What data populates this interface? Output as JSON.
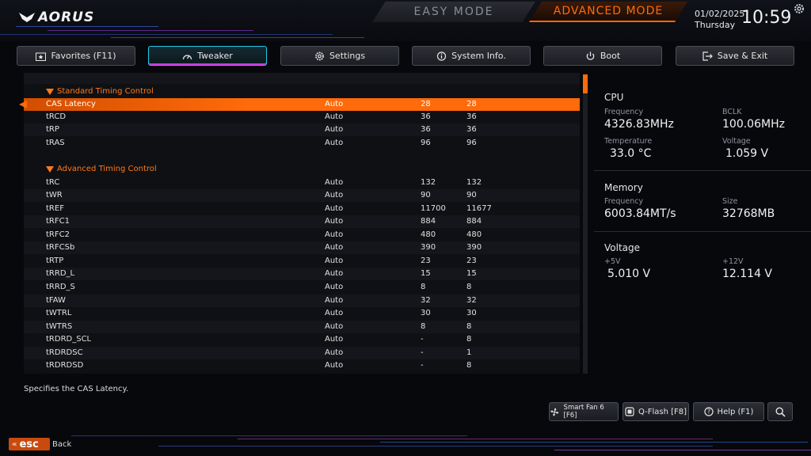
{
  "header": {
    "logo": "AORUS",
    "modes": {
      "easy": "EASY MODE",
      "advanced": "ADVANCED MODE"
    },
    "date": "01/02/2025",
    "day": "Thursday",
    "time": "10:59"
  },
  "tabs": [
    {
      "label": "Favorites (F11)",
      "icon": "star-folder-icon"
    },
    {
      "label": "Tweaker",
      "icon": "speedometer-icon",
      "active": true
    },
    {
      "label": "Settings",
      "icon": "gear-icon"
    },
    {
      "label": "System Info.",
      "icon": "info-icon"
    },
    {
      "label": "Boot",
      "icon": "power-icon"
    },
    {
      "label": "Save & Exit",
      "icon": "exit-icon"
    }
  ],
  "sections": [
    {
      "label": "Standard Timing Control"
    },
    {
      "label": "Advanced Timing Control"
    }
  ],
  "standard_rows": [
    {
      "name": "CAS Latency",
      "mode": "Auto",
      "a": "28",
      "b": "28",
      "selected": true
    },
    {
      "name": "tRCD",
      "mode": "Auto",
      "a": "36",
      "b": "36"
    },
    {
      "name": "tRP",
      "mode": "Auto",
      "a": "36",
      "b": "36"
    },
    {
      "name": "tRAS",
      "mode": "Auto",
      "a": "96",
      "b": "96"
    }
  ],
  "advanced_rows": [
    {
      "name": "tRC",
      "mode": "Auto",
      "a": "132",
      "b": "132"
    },
    {
      "name": "tWR",
      "mode": "Auto",
      "a": "90",
      "b": "90"
    },
    {
      "name": "tREF",
      "mode": "Auto",
      "a": "11700",
      "b": "11677"
    },
    {
      "name": "tRFC1",
      "mode": "Auto",
      "a": "884",
      "b": "884"
    },
    {
      "name": "tRFC2",
      "mode": "Auto",
      "a": "480",
      "b": "480"
    },
    {
      "name": "tRFCSb",
      "mode": "Auto",
      "a": "390",
      "b": "390"
    },
    {
      "name": "tRTP",
      "mode": "Auto",
      "a": "23",
      "b": "23"
    },
    {
      "name": "tRRD_L",
      "mode": "Auto",
      "a": "15",
      "b": "15"
    },
    {
      "name": "tRRD_S",
      "mode": "Auto",
      "a": "8",
      "b": "8"
    },
    {
      "name": "tFAW",
      "mode": "Auto",
      "a": "32",
      "b": "32"
    },
    {
      "name": "tWTRL",
      "mode": "Auto",
      "a": "30",
      "b": "30"
    },
    {
      "name": "tWTRS",
      "mode": "Auto",
      "a": "8",
      "b": "8"
    },
    {
      "name": "tRDRD_SCL",
      "mode": "Auto",
      "a": "-",
      "b": "8"
    },
    {
      "name": "tRDRDSC",
      "mode": "Auto",
      "a": "-",
      "b": "1"
    },
    {
      "name": "tRDRDSD",
      "mode": "Auto",
      "a": "-",
      "b": "8"
    }
  ],
  "info": {
    "cpu": {
      "title": "CPU",
      "frequency_label": "Frequency",
      "frequency": "4326.83MHz",
      "bclk_label": "BCLK",
      "bclk": "100.06MHz",
      "temp_label": "Temperature",
      "temp": "33.0 °C",
      "voltage_label": "Voltage",
      "voltage": "1.059 V"
    },
    "memory": {
      "title": "Memory",
      "frequency_label": "Frequency",
      "frequency": "6003.84MT/s",
      "size_label": "Size",
      "size": "32768MB"
    },
    "voltage": {
      "title": "Voltage",
      "v5_label": "+5V",
      "v5": "5.010 V",
      "v12_label": "+12V",
      "v12": "12.114 V"
    }
  },
  "footer": {
    "description": "Specifies the CAS Latency.",
    "buttons": {
      "smart_fan": "Smart Fan 6 [F6]",
      "qflash": "Q-Flash [F8]",
      "help": "Help (F1)"
    },
    "esc": "esc",
    "back": "Back"
  },
  "colors": {
    "accent": "#ff6a0a",
    "tab_active": "#21c9e6",
    "tab_active_under": "#d32bd8",
    "background": "#07080c"
  }
}
